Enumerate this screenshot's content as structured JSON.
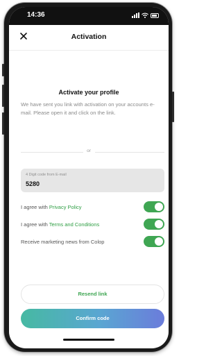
{
  "status_bar": {
    "time": "14:36"
  },
  "header": {
    "title": "Activation"
  },
  "main": {
    "section_title": "Activate your profile",
    "description": "We have sent you link with activation on your accounts e-mail. Please open it and click on the link.",
    "or_label": "or",
    "code_field": {
      "label": "4 Digit code from E-mail",
      "value": "5280"
    }
  },
  "agreements": [
    {
      "prefix": "I agree with ",
      "link": "Privacy Policy",
      "checked": true
    },
    {
      "prefix": "I agree with ",
      "link": "Terms and Conditions",
      "checked": true
    },
    {
      "prefix": "Receive marketing news from Colop",
      "link": "",
      "checked": true
    }
  ],
  "buttons": {
    "resend": "Resend link",
    "confirm": "Confirm code"
  },
  "colors": {
    "accent_green": "#3fa653",
    "gradient_start": "#46b9a2",
    "gradient_end": "#6b7cdb"
  },
  "icons": {
    "close": "close-icon",
    "signal": "signal-icon",
    "wifi": "wifi-icon",
    "battery": "battery-icon"
  }
}
